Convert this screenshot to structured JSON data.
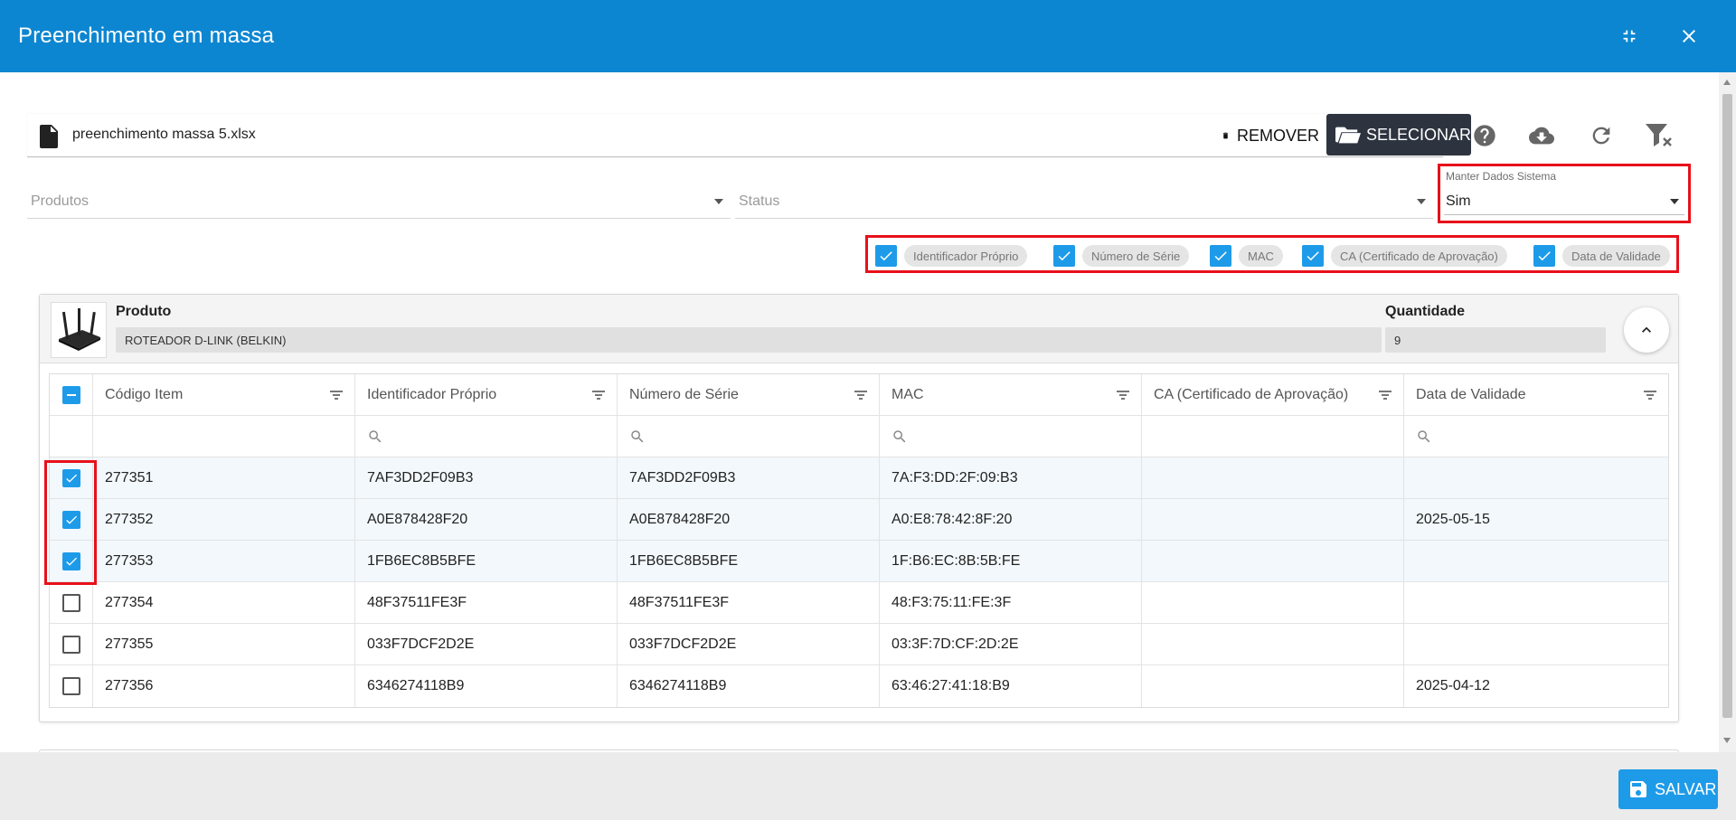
{
  "dialog": {
    "title": "Preenchimento em massa"
  },
  "file": {
    "name": "preenchimento massa 5.xlsx",
    "remove_label": "REMOVER",
    "select_label": "SELECIONAR"
  },
  "toolbar": {
    "icons": [
      "help-icon",
      "cloud-download-icon",
      "refresh-icon",
      "clear-filter-icon"
    ]
  },
  "filters": {
    "produtos_placeholder": "Produtos",
    "status_placeholder": "Status",
    "manter_label": "Manter Dados Sistema",
    "manter_value": "Sim"
  },
  "column_toggles": [
    {
      "label": "Identificador Próprio",
      "checked": true
    },
    {
      "label": "Número de Série",
      "checked": true
    },
    {
      "label": "MAC",
      "checked": true
    },
    {
      "label": "CA (Certificado de Aprovação)",
      "checked": true
    },
    {
      "label": "Data de Validade",
      "checked": true
    }
  ],
  "product": {
    "product_label": "Produto",
    "product_value": "ROTEADOR D-LINK (BELKIN)",
    "quantity_label": "Quantidade",
    "quantity_value": "9"
  },
  "grid": {
    "columns": [
      "Código Item",
      "Identificador Próprio",
      "Número de Série",
      "MAC",
      "CA (Certificado de Aprovação)",
      "Data de Validade"
    ],
    "rows": [
      {
        "selected": true,
        "codigo": "277351",
        "identificador": "7AF3DD2F09B3",
        "serie": "7AF3DD2F09B3",
        "mac": "7A:F3:DD:2F:09:B3",
        "ca": "",
        "validade": ""
      },
      {
        "selected": true,
        "codigo": "277352",
        "identificador": "A0E878428F20",
        "serie": "A0E878428F20",
        "mac": "A0:E8:78:42:8F:20",
        "ca": "",
        "validade": "2025-05-15"
      },
      {
        "selected": true,
        "codigo": "277353",
        "identificador": "1FB6EC8B5BFE",
        "serie": "1FB6EC8B5BFE",
        "mac": "1F:B6:EC:8B:5B:FE",
        "ca": "",
        "validade": ""
      },
      {
        "selected": false,
        "codigo": "277354",
        "identificador": "48F37511FE3F",
        "serie": "48F37511FE3F",
        "mac": "48:F3:75:11:FE:3F",
        "ca": "",
        "validade": ""
      },
      {
        "selected": false,
        "codigo": "277355",
        "identificador": "033F7DCF2D2E",
        "serie": "033F7DCF2D2E",
        "mac": "03:3F:7D:CF:2D:2E",
        "ca": "",
        "validade": ""
      },
      {
        "selected": false,
        "codigo": "277356",
        "identificador": "6346274118B9",
        "serie": "6346274118B9",
        "mac": "63:46:27:41:18:B9",
        "ca": "",
        "validade": "2025-04-12"
      }
    ]
  },
  "footer": {
    "save_label": "SALVAR"
  },
  "colors": {
    "header": "#0d86d1",
    "accent": "#1e9be8",
    "highlight": "#e8101a",
    "dark_button": "#2d3440"
  }
}
